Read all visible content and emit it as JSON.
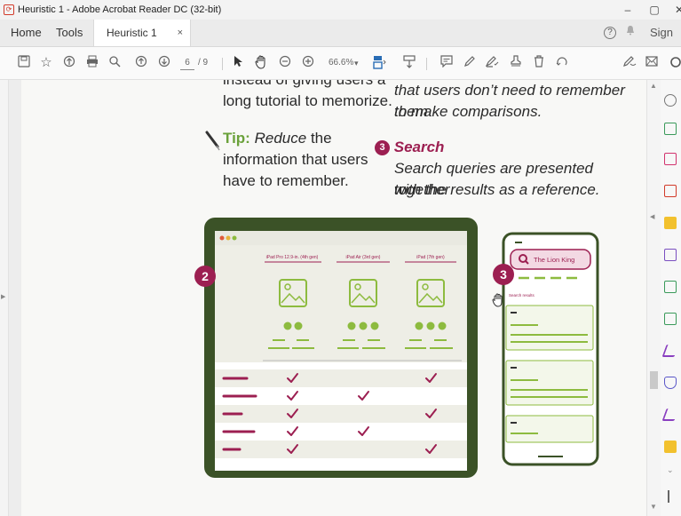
{
  "window": {
    "title": "Heuristic 1 - Adobe Acrobat Reader DC (32-bit)",
    "controls": [
      "–",
      "▢",
      "✕"
    ]
  },
  "tabs": {
    "home": "Home",
    "tools": "Tools",
    "document": "Heuristic 1",
    "close": "×",
    "sign_in": "Sign In",
    "help": "?",
    "bell": "♟"
  },
  "toolbar": {
    "page_current": "6",
    "page_total": "/ 9",
    "zoom": "66.6%",
    "zoom_arrow": "▾",
    "icons": [
      "save-icon",
      "bookmark-star-icon",
      "upload-icon",
      "print-icon",
      "zoom-search-icon",
      "page-up-icon",
      "page-down-icon",
      "select-cursor-icon",
      "hand-tool-icon",
      "zoom-out-icon",
      "zoom-in-icon",
      "fit-page-icon",
      "scroll-mode-icon",
      "comment-icon",
      "highlight-pen-icon",
      "sign-icon",
      "stamp-icon",
      "delete-icon",
      "rotate-icon",
      "tools-pencil-icon",
      "mail-icon",
      "more-icon"
    ]
  },
  "document": {
    "line1_left": "instead of giving users a",
    "line2_left": "long tutorial to memorize.",
    "tip_label": "Tip:",
    "tip_reduce": "Reduce",
    "tip_rest1": "the",
    "tip_line2": "information that users",
    "tip_line3": "have to remember.",
    "line1_right": "that users don’t need to remember them",
    "line2_right": "to make comparisons.",
    "search_number": "3",
    "search_title": "Search",
    "search_line1": "Search queries are presented together",
    "search_line2": "with the results as a reference."
  },
  "illustration": {
    "badge_left": "2",
    "badge_right": "3",
    "columns": [
      "iPad Pro 12.9-in. (4th gen)",
      "iPad Air (3rd gen)",
      "iPad (7th gen)"
    ],
    "phone_search": "The Lion King",
    "search_results": "Search results",
    "checks": [
      [
        true,
        false,
        true
      ],
      [
        true,
        true,
        false
      ],
      [
        true,
        false,
        true
      ],
      [
        true,
        true,
        false
      ],
      [
        true,
        false,
        true
      ]
    ]
  },
  "colors": {
    "frame_green": "#3b5227",
    "accent_green": "#8dbb3f",
    "accent_magenta": "#9c1f51"
  }
}
